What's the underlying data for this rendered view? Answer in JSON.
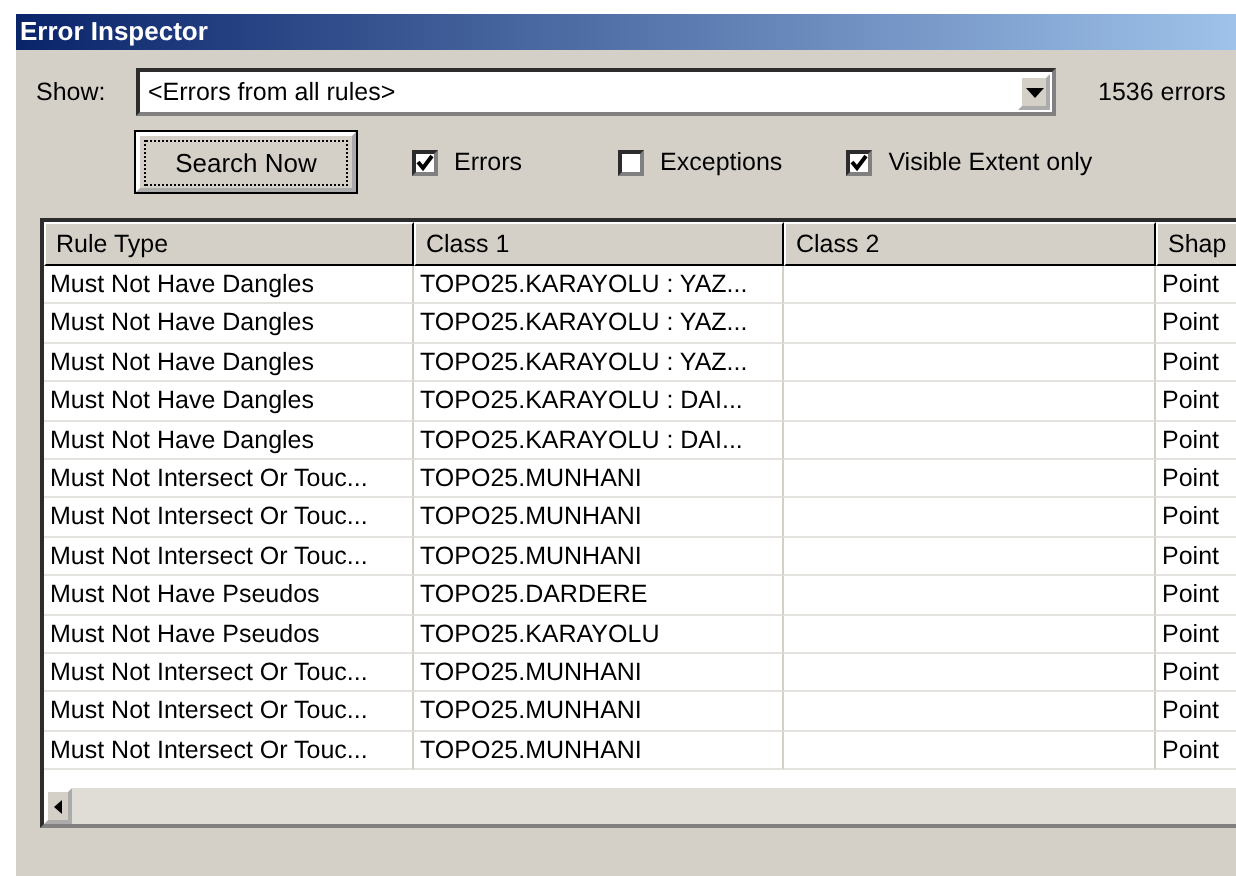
{
  "window": {
    "title": "Error Inspector"
  },
  "show": {
    "label": "Show:",
    "value": "<Errors from all rules>",
    "count": "1536 errors"
  },
  "search_button": "Search Now",
  "options": [
    {
      "label": "Errors",
      "checked": true
    },
    {
      "label": "Exceptions",
      "checked": false
    },
    {
      "label": "Visible Extent only",
      "checked": true
    }
  ],
  "table": {
    "columns": [
      "Rule Type",
      "Class 1",
      "Class 2",
      "Shap"
    ],
    "rows": [
      [
        "Must Not Have Dangles",
        "TOPO25.KARAYOLU : YAZ...",
        "",
        "Point"
      ],
      [
        "Must Not Have Dangles",
        "TOPO25.KARAYOLU : YAZ...",
        "",
        "Point"
      ],
      [
        "Must Not Have Dangles",
        "TOPO25.KARAYOLU : YAZ...",
        "",
        "Point"
      ],
      [
        "Must Not Have Dangles",
        "TOPO25.KARAYOLU : DAI...",
        "",
        "Point"
      ],
      [
        "Must Not Have Dangles",
        "TOPO25.KARAYOLU : DAI...",
        "",
        "Point"
      ],
      [
        "Must Not Intersect Or Touc...",
        "TOPO25.MUNHANI",
        "",
        "Point"
      ],
      [
        "Must Not Intersect Or Touc...",
        "TOPO25.MUNHANI",
        "",
        "Point"
      ],
      [
        "Must Not Intersect Or Touc...",
        "TOPO25.MUNHANI",
        "",
        "Point"
      ],
      [
        "Must Not Have Pseudos",
        "TOPO25.DARDERE",
        "",
        "Point"
      ],
      [
        "Must Not Have Pseudos",
        "TOPO25.KARAYOLU",
        "",
        "Point"
      ],
      [
        "Must Not Intersect Or Touc...",
        "TOPO25.MUNHANI",
        "",
        "Point"
      ],
      [
        "Must Not Intersect Or Touc...",
        "TOPO25.MUNHANI",
        "",
        "Point"
      ],
      [
        "Must Not Intersect Or Touc...",
        "TOPO25.MUNHANI",
        "",
        "Point"
      ]
    ]
  }
}
